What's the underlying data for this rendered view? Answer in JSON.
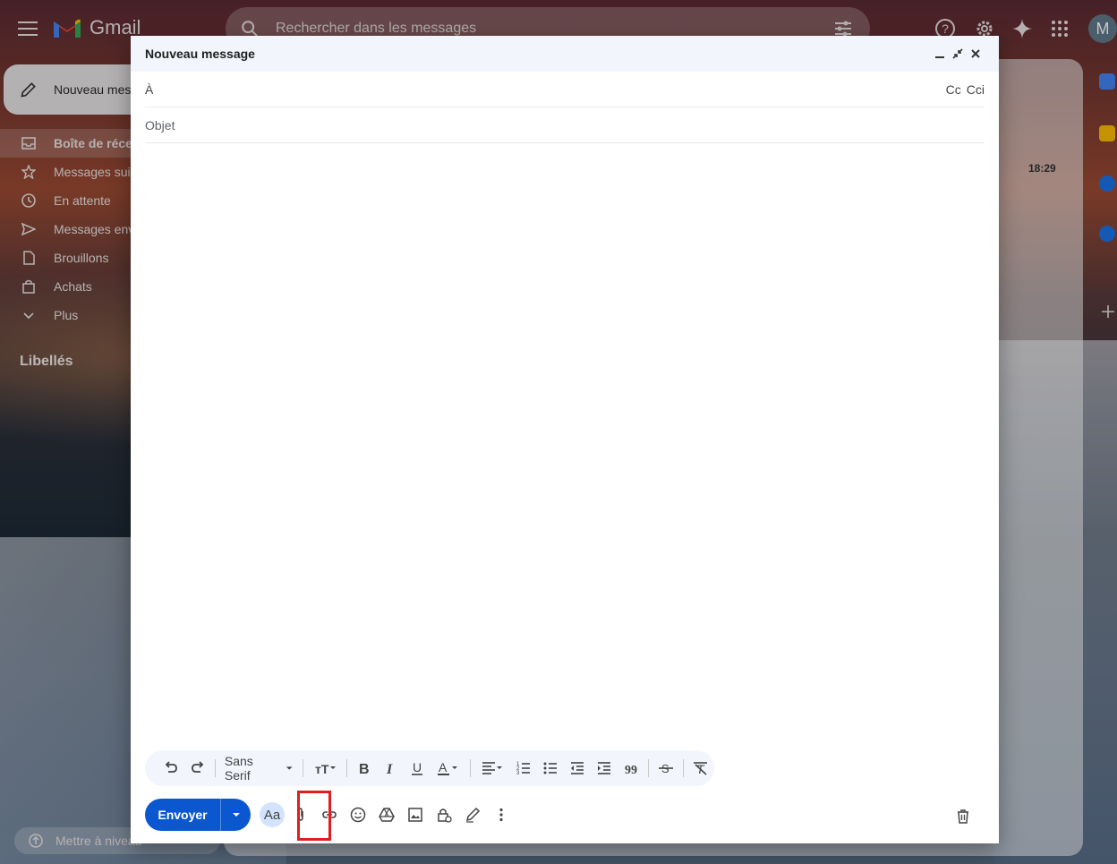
{
  "topbar": {
    "app_name": "Gmail",
    "search_placeholder": "Rechercher dans les messages",
    "avatar_initial": "M"
  },
  "nav": {
    "compose_label": "Nouveau message",
    "items": [
      {
        "label": "Boîte de réception",
        "icon": "inbox-icon",
        "active": true
      },
      {
        "label": "Messages suivis",
        "icon": "star-icon"
      },
      {
        "label": "En attente",
        "icon": "clock-icon"
      },
      {
        "label": "Messages envoyés",
        "icon": "send-icon"
      },
      {
        "label": "Brouillons",
        "icon": "draft-icon"
      },
      {
        "label": "Achats",
        "icon": "shopping-icon"
      },
      {
        "label": "Plus",
        "icon": "chevron-down-icon"
      }
    ],
    "labels_title": "Libellés",
    "upgrade_label": "Mettre à niveau"
  },
  "mail_list": {
    "first_time": "18:29"
  },
  "compose": {
    "title": "Nouveau message",
    "to_label": "À",
    "cc_label": "Cc",
    "bcc_label": "Cci",
    "subject_placeholder": "Objet",
    "font_name": "Sans Serif",
    "send_label": "Envoyer",
    "formatting_label": "Aa"
  },
  "colors": {
    "send_button": "#0b57d0",
    "highlight_box": "#e01e1e",
    "header_bg": "#f2f6fc"
  }
}
